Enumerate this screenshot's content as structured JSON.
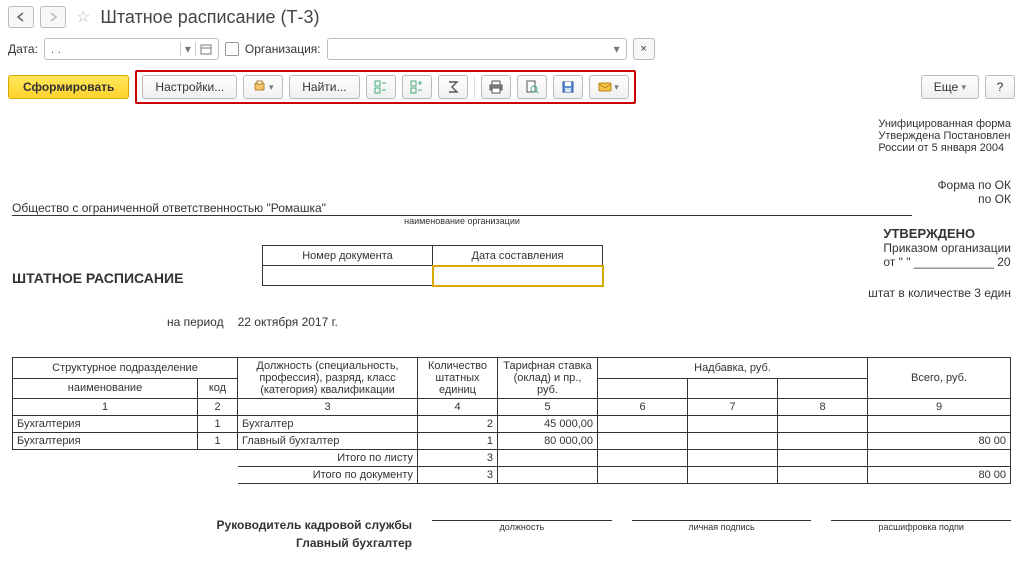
{
  "titlebar": {
    "title": "Штатное расписание (Т-3)"
  },
  "filter": {
    "date_label": "Дата:",
    "date_value": ". .",
    "org_label": "Организация:"
  },
  "toolbar": {
    "form_btn": "Сформировать",
    "settings_btn": "Настройки...",
    "find_btn": "Найти...",
    "more_btn": "Еще",
    "help_btn": "?"
  },
  "form_meta": {
    "line1": "Унифицированная форма",
    "line2": "Утверждена Постановлен",
    "line3": "России от 5 января 2004",
    "code1": "Форма по ОК",
    "code2": "по ОК"
  },
  "report": {
    "org_name": "Общество с ограниченной ответственностью \"Ромашка\"",
    "org_caption": "наименование организации",
    "doc_title": "ШТАТНОЕ РАСПИСАНИЕ",
    "doc_num_label": "Номер документа",
    "doc_date_label": "Дата составления",
    "approved": "УТВЕРЖДЕНО",
    "approved_by": "Приказом организации",
    "approved_from": "от  \"        \"  ____________ 20",
    "staff_count": "штат в количестве 3 един",
    "period_label": "на период",
    "period_value": "22 октября 2017 г."
  },
  "table": {
    "headers": {
      "dept_group": "Структурное  подразделение",
      "dept_name": "наименование",
      "dept_code": "код",
      "position": "Должность (специальность, профессия), разряд, класс (категория) квалификации",
      "units": "Количество штатных единиц",
      "rate": "Тарифная ставка (оклад) и пр., руб.",
      "bonus_group": "Надбавка, руб.",
      "total": "Всего, руб.",
      "n1": "1",
      "n2": "2",
      "n3": "3",
      "n4": "4",
      "n5": "5",
      "n6": "6",
      "n7": "7",
      "n8": "8",
      "n9": "9"
    },
    "rows": [
      {
        "dept": "Бухгалтерия",
        "code": "1",
        "pos": "Бухгалтер",
        "units": "2",
        "rate": "45 000,00",
        "b1": "",
        "b2": "",
        "b3": "",
        "total": ""
      },
      {
        "dept": "Бухгалтерия",
        "code": "1",
        "pos": "Главный бухгалтер",
        "units": "1",
        "rate": "80 000,00",
        "b1": "",
        "b2": "",
        "b3": "",
        "total": "80 00"
      }
    ],
    "totals": [
      {
        "label": "Итого по листу",
        "units": "3",
        "rate": "",
        "b1": "",
        "b2": "",
        "b3": "",
        "total": ""
      },
      {
        "label": "Итого по документу",
        "units": "3",
        "rate": "",
        "b1": "",
        "b2": "",
        "b3": "",
        "total": "80 00"
      }
    ]
  },
  "signatures": {
    "hr_head": "Руководитель кадровой службы",
    "chief_acc": "Главный бухгалтер",
    "position": "должность",
    "signature": "личная подпись",
    "decryption": "расшифровка  подпи"
  }
}
